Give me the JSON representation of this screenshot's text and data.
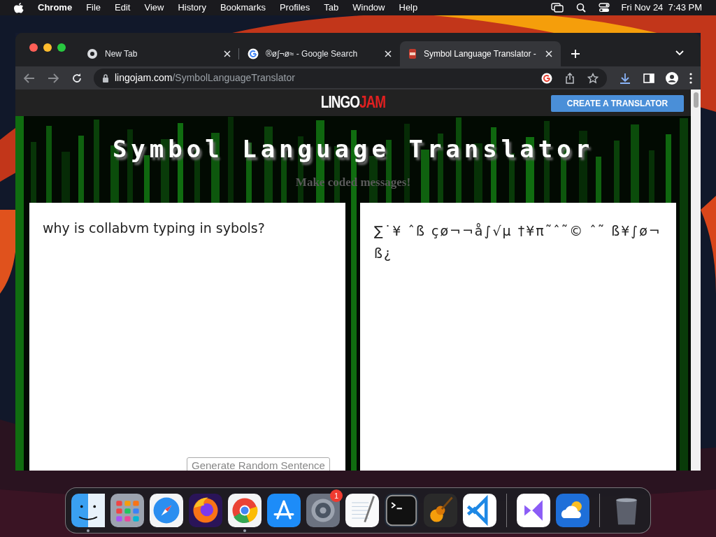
{
  "menu_bar": {
    "app": "Chrome",
    "items": [
      "File",
      "Edit",
      "View",
      "History",
      "Bookmarks",
      "Profiles",
      "Tab",
      "Window",
      "Help"
    ],
    "clock": "Fri Nov 24  7:43 PM"
  },
  "tabs": [
    {
      "title": "New Tab",
      "kind": "newtab",
      "selected": false
    },
    {
      "title": "®ø∫¬ø≈ - Google Search",
      "kind": "google",
      "selected": false
    },
    {
      "title": "Symbol Language Translator -",
      "kind": "site",
      "selected": true
    }
  ],
  "address": {
    "host": "lingojam.com",
    "path": "/SymbolLanguageTranslator"
  },
  "site": {
    "logo_left": "LINGO",
    "logo_right": "JAM",
    "create_button": "CREATE A TRANSLATOR",
    "title": "Symbol Language Translator",
    "subtitle": "Make coded messages!",
    "input_text": "why is collabvm typing in sybols?",
    "output_text": "∑˙¥ ˆß çø¬¬å∫√µ †¥π˜ˆ˜© ˆ˜ ß¥∫ø¬ ß¿",
    "random_button": "Generate Random Sentence"
  },
  "dock": [
    {
      "kind": "finder",
      "running": true
    },
    {
      "kind": "launchpad",
      "running": false
    },
    {
      "kind": "safari",
      "running": false
    },
    {
      "kind": "firefox",
      "running": false
    },
    {
      "kind": "chrome",
      "running": true
    },
    {
      "kind": "appstore",
      "running": false
    },
    {
      "kind": "settings",
      "running": false,
      "badge": "1"
    },
    {
      "kind": "textedit",
      "running": false
    },
    {
      "kind": "terminal",
      "running": false
    },
    {
      "kind": "guitar",
      "running": false
    },
    {
      "kind": "vscode",
      "running": false
    },
    {
      "kind": "divider"
    },
    {
      "kind": "vstudio",
      "running": false
    },
    {
      "kind": "weather",
      "running": false
    },
    {
      "kind": "divider"
    },
    {
      "kind": "trash",
      "running": false
    }
  ]
}
